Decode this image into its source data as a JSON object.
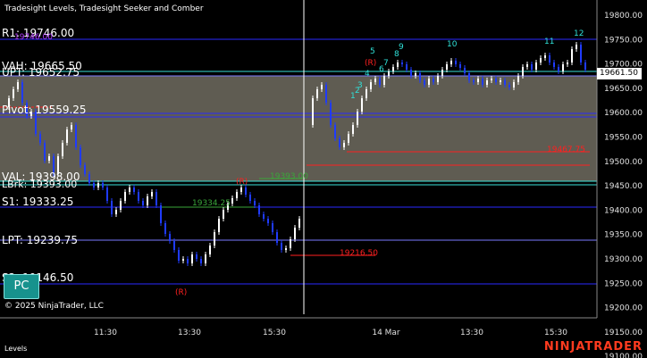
{
  "header": {
    "indicators_title": "Tradesight Levels, Tradesight Seeker and Comber"
  },
  "levels": {
    "r1": "R1: 19746.00",
    "r1_overlay": "19746.00",
    "vah": "VAH: 19665.50",
    "upt": "UPT: 19652.75",
    "pivot": "Pivot: 19559.25",
    "val": "VAL: 19398.00",
    "lbrk": "LBrk: 19393.00",
    "s1": "S1: 19333.25",
    "lpt": "LPT: 19239.75",
    "s2": "S2: 19146.50"
  },
  "annotations": {
    "red_level_right": "19467.75",
    "red_level_low": "19216.50",
    "green_level_mid": "19334.25",
    "green_level_high": "19393.00",
    "seq_top": [
      "5",
      "8",
      "9",
      "10",
      "11",
      "12"
    ],
    "seq_mid": [
      "1",
      "2",
      "3",
      "4",
      "6",
      "7"
    ],
    "r_marks": [
      "(R)",
      "(R)",
      "(R)"
    ]
  },
  "price_axis": {
    "ticks": [
      "19800.00",
      "19750.00",
      "19700.00",
      "19650.00",
      "19600.00",
      "19550.00",
      "19500.00",
      "19450.00",
      "19400.00",
      "19350.00",
      "19300.00",
      "19250.00",
      "19200.00",
      "19150.00",
      "19100.00"
    ],
    "last_price": "19661.50"
  },
  "time_axis": {
    "ticks": [
      "11:30",
      "13:30",
      "15:30",
      "14 Mar",
      "13:30",
      "15:30"
    ]
  },
  "buttons": {
    "pc": "PC"
  },
  "footer": {
    "copyright": "© 2025 NinjaTrader, LLC",
    "tab_name": "Levels",
    "brand": "NINJATRADER"
  },
  "colors": {
    "background": "#000000",
    "value_area_fill": "#5f5c52",
    "up_candle": "#ffffff",
    "down_candle": "#1f3bff",
    "level_blue": "#2a2aff",
    "level_cyan": "#38e0d8",
    "level_red": "#ff2020",
    "level_green": "#3aa63a",
    "seeker_cyan": "#2fe0d8",
    "comber_green": "#3aa63a"
  }
}
